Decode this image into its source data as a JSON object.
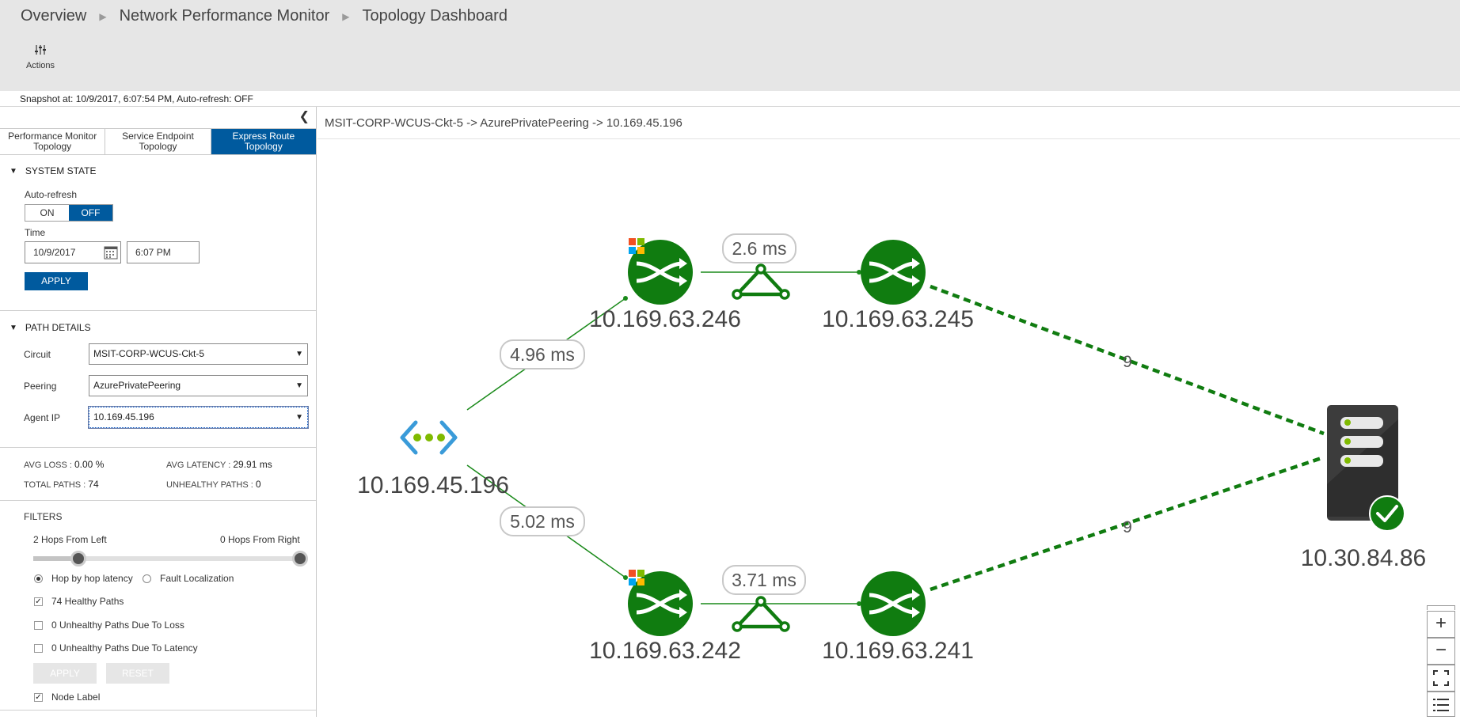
{
  "breadcrumb": [
    "Overview",
    "Network Performance Monitor",
    "Topology Dashboard"
  ],
  "toolbar": {
    "actions_label": "Actions"
  },
  "snapshot": "Snapshot at: 10/9/2017, 6:07:54 PM, Auto-refresh: OFF",
  "tabs": [
    {
      "line1": "Performance Monitor",
      "line2": "Topology",
      "active": false
    },
    {
      "line1": "Service Endpoint",
      "line2": "Topology",
      "active": false
    },
    {
      "line1": "Express Route",
      "line2": "Topology",
      "active": true
    }
  ],
  "system_state": {
    "title": "SYSTEM STATE",
    "auto_refresh_label": "Auto-refresh",
    "on_label": "ON",
    "off_label": "OFF",
    "auto_refresh_value": "OFF",
    "time_label": "Time",
    "date_value": "10/9/2017",
    "time_value": "6:07 PM",
    "apply_label": "APPLY"
  },
  "path_details": {
    "title": "PATH DETAILS",
    "circuit_label": "Circuit",
    "circuit_value": "MSIT-CORP-WCUS-Ckt-5",
    "peering_label": "Peering",
    "peering_value": "AzurePrivatePeering",
    "agent_ip_label": "Agent IP",
    "agent_ip_value": "10.169.45.196"
  },
  "stats": {
    "avg_loss_label": "AVG LOSS : ",
    "avg_loss_value": "0.00 %",
    "avg_latency_label": "AVG LATENCY : ",
    "avg_latency_value": "29.91 ms",
    "total_paths_label": "TOTAL PATHS : ",
    "total_paths_value": "74",
    "unhealthy_paths_label": "UNHEALTHY PATHS : ",
    "unhealthy_paths_value": "0"
  },
  "filters": {
    "title": "FILTERS",
    "hops_left": "2 Hops From Left",
    "hops_right": "0 Hops From Right",
    "radio_hop": "Hop by hop latency",
    "radio_fault": "Fault Localization",
    "selected_radio": "Hop by hop latency",
    "healthy": "74 Healthy Paths",
    "healthy_checked": true,
    "unhealthy_loss": "0 Unhealthy Paths Due To Loss",
    "unhealthy_loss_checked": false,
    "unhealthy_latency": "0 Unhealthy Paths Due To Latency",
    "unhealthy_latency_checked": false,
    "apply_label": "APPLY",
    "reset_label": "RESET",
    "node_label": "Node Label",
    "node_label_checked": true
  },
  "main": {
    "path_title": "MSIT-CORP-WCUS-Ckt-5 -> AzurePrivatePeering -> 10.169.45.196"
  },
  "topology": {
    "source": "10.169.45.196",
    "hops": [
      "10.169.63.246",
      "10.169.63.245",
      "10.169.63.242",
      "10.169.63.241"
    ],
    "destination": "10.30.84.86",
    "latency_top_in": "4.96 ms",
    "latency_top_link": "2.6 ms",
    "latency_bottom_in": "5.02 ms",
    "latency_bottom_link": "3.71 ms",
    "dashed_top_count": "9",
    "dashed_bottom_count": "9"
  },
  "zoom_controls": {
    "zoom_in": "+",
    "zoom_out": "−"
  },
  "colors": {
    "accent": "#005a9e",
    "node_green": "#107c10",
    "link_green": "#1a8a1a",
    "server_gray": "#3c3c3c",
    "agent_blue": "#3a9bd9",
    "agent_dots": "#7fba00"
  },
  "icons": [
    "actions-sliders-icon",
    "calendar-icon",
    "router-icon",
    "microsoft-logo-icon",
    "express-route-icon",
    "agent-icon",
    "server-icon",
    "healthy-check-icon",
    "fit-icon",
    "legend-list-icon"
  ]
}
